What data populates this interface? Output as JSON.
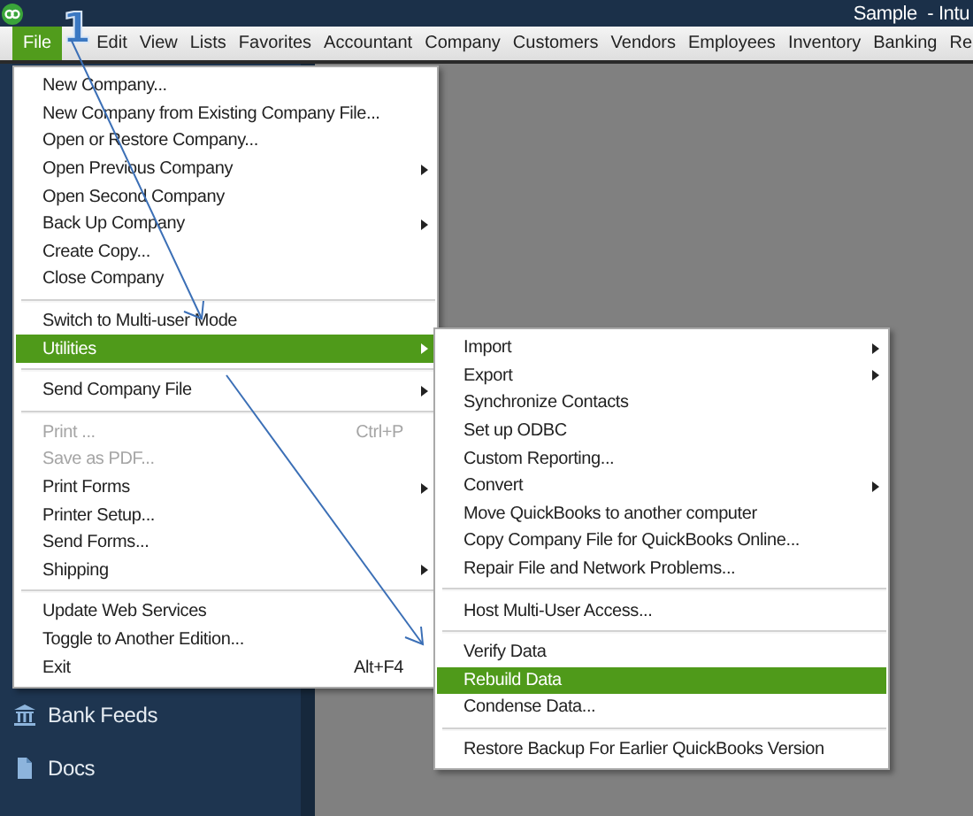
{
  "window": {
    "title": "Sample  - Intu"
  },
  "menu_bar": [
    {
      "label": "File",
      "selected": true
    },
    {
      "label": "Edit",
      "selected": false
    },
    {
      "label": "View",
      "selected": false
    },
    {
      "label": "Lists",
      "selected": false
    },
    {
      "label": "Favorites",
      "selected": false
    },
    {
      "label": "Accountant",
      "selected": false
    },
    {
      "label": "Company",
      "selected": false
    },
    {
      "label": "Customers",
      "selected": false
    },
    {
      "label": "Vendors",
      "selected": false
    },
    {
      "label": "Employees",
      "selected": false
    },
    {
      "label": "Inventory",
      "selected": false
    },
    {
      "label": "Banking",
      "selected": false
    },
    {
      "label": "Re",
      "selected": false
    }
  ],
  "step_badge": "1",
  "sidebar": {
    "items": [
      {
        "label": "Bank Feeds"
      },
      {
        "label": "Docs"
      }
    ]
  },
  "file_menu": [
    {
      "kind": "item",
      "label": "New Company...",
      "selected": false,
      "disabled": false,
      "submenu": false
    },
    {
      "kind": "item",
      "label": "New Company from Existing Company File...",
      "selected": false,
      "disabled": false,
      "submenu": false
    },
    {
      "kind": "item",
      "label": "Open or Restore Company...",
      "selected": false,
      "disabled": false,
      "submenu": false
    },
    {
      "kind": "item",
      "label": "Open Previous Company",
      "selected": false,
      "disabled": false,
      "submenu": true
    },
    {
      "kind": "item",
      "label": "Open Second Company",
      "selected": false,
      "disabled": false,
      "submenu": false
    },
    {
      "kind": "item",
      "label": "Back Up Company",
      "selected": false,
      "disabled": false,
      "submenu": true
    },
    {
      "kind": "item",
      "label": "Create Copy...",
      "selected": false,
      "disabled": false,
      "submenu": false
    },
    {
      "kind": "item",
      "label": "Close Company",
      "selected": false,
      "disabled": false,
      "submenu": false
    },
    {
      "kind": "separator"
    },
    {
      "kind": "item",
      "label": "Switch to Multi-user Mode",
      "selected": false,
      "disabled": false,
      "submenu": false
    },
    {
      "kind": "item",
      "label": "Utilities",
      "selected": true,
      "disabled": false,
      "submenu": true
    },
    {
      "kind": "separator"
    },
    {
      "kind": "item",
      "label": "Send Company File",
      "selected": false,
      "disabled": false,
      "submenu": true
    },
    {
      "kind": "separator"
    },
    {
      "kind": "item",
      "label": "Print ...",
      "shortcut": "Ctrl+P",
      "selected": false,
      "disabled": true,
      "submenu": false
    },
    {
      "kind": "item",
      "label": "Save as PDF...",
      "selected": false,
      "disabled": true,
      "submenu": false
    },
    {
      "kind": "item",
      "label": "Print Forms",
      "selected": false,
      "disabled": false,
      "submenu": true
    },
    {
      "kind": "item",
      "label": "Printer Setup...",
      "selected": false,
      "disabled": false,
      "submenu": false
    },
    {
      "kind": "item",
      "label": "Send Forms...",
      "selected": false,
      "disabled": false,
      "submenu": false
    },
    {
      "kind": "item",
      "label": "Shipping",
      "selected": false,
      "disabled": false,
      "submenu": true
    },
    {
      "kind": "separator"
    },
    {
      "kind": "item",
      "label": "Update Web Services",
      "selected": false,
      "disabled": false,
      "submenu": false
    },
    {
      "kind": "item",
      "label": "Toggle to Another Edition...",
      "selected": false,
      "disabled": false,
      "submenu": false
    },
    {
      "kind": "item",
      "label": "Exit",
      "shortcut": "Alt+F4",
      "selected": false,
      "disabled": false,
      "submenu": false
    }
  ],
  "utilities_menu": [
    {
      "kind": "item",
      "label": "Import",
      "selected": false,
      "disabled": false,
      "submenu": true
    },
    {
      "kind": "item",
      "label": "Export",
      "selected": false,
      "disabled": false,
      "submenu": true
    },
    {
      "kind": "item",
      "label": "Synchronize Contacts",
      "selected": false,
      "disabled": false,
      "submenu": false
    },
    {
      "kind": "item",
      "label": "Set up ODBC",
      "selected": false,
      "disabled": false,
      "submenu": false
    },
    {
      "kind": "item",
      "label": "Custom Reporting...",
      "selected": false,
      "disabled": false,
      "submenu": false
    },
    {
      "kind": "item",
      "label": "Convert",
      "selected": false,
      "disabled": false,
      "submenu": true
    },
    {
      "kind": "item",
      "label": "Move QuickBooks to another computer",
      "selected": false,
      "disabled": false,
      "submenu": false
    },
    {
      "kind": "item",
      "label": "Copy Company File for QuickBooks Online...",
      "selected": false,
      "disabled": false,
      "submenu": false
    },
    {
      "kind": "item",
      "label": "Repair File and Network Problems...",
      "selected": false,
      "disabled": false,
      "submenu": false
    },
    {
      "kind": "separator"
    },
    {
      "kind": "item",
      "label": "Host Multi-User Access...",
      "selected": false,
      "disabled": false,
      "submenu": false
    },
    {
      "kind": "separator"
    },
    {
      "kind": "item",
      "label": "Verify Data",
      "selected": false,
      "disabled": false,
      "submenu": false
    },
    {
      "kind": "item",
      "label": "Rebuild Data",
      "selected": true,
      "disabled": false,
      "submenu": false
    },
    {
      "kind": "item",
      "label": "Condense Data...",
      "selected": false,
      "disabled": false,
      "submenu": false
    },
    {
      "kind": "separator"
    },
    {
      "kind": "item",
      "label": "Restore Backup For Earlier QuickBooks Version",
      "selected": false,
      "disabled": false,
      "submenu": false
    }
  ]
}
